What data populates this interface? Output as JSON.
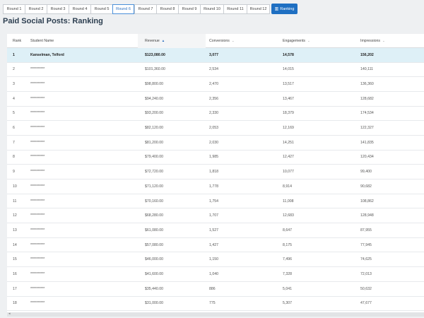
{
  "rounds": [
    "Round 1",
    "Round 2",
    "Round 3",
    "Round 4",
    "Round 5",
    "Round 6",
    "Round 7",
    "Round 8",
    "Round 9",
    "Round 10",
    "Round 11",
    "Round 12"
  ],
  "active_round": "Round 6",
  "ranking_button": {
    "label": "Ranking",
    "icon": "chart-icon"
  },
  "page_title": "Paid Social Posts: Ranking",
  "table": {
    "headers": {
      "rank": "Rank",
      "name": "Student Name",
      "revenue": "Revenue",
      "conversions": "Conversions",
      "engagements": "Engagements",
      "impressions": "Impressions"
    },
    "rows": [
      {
        "rank": "1",
        "name": "Kanselman, Telford",
        "revenue": "$123,080.00",
        "conversions": "3,077",
        "engagements": "14,578",
        "impressions": "156,202"
      },
      {
        "rank": "2",
        "name": "**********",
        "revenue": "$101,360.00",
        "conversions": "2,534",
        "engagements": "14,015",
        "impressions": "140,111"
      },
      {
        "rank": "3",
        "name": "**********",
        "revenue": "$98,800.00",
        "conversions": "2,470",
        "engagements": "13,517",
        "impressions": "136,360"
      },
      {
        "rank": "4",
        "name": "**********",
        "revenue": "$94,240.00",
        "conversions": "2,356",
        "engagements": "13,467",
        "impressions": "128,682"
      },
      {
        "rank": "5",
        "name": "**********",
        "revenue": "$93,200.00",
        "conversions": "2,330",
        "engagements": "18,379",
        "impressions": "174,534"
      },
      {
        "rank": "6",
        "name": "**********",
        "revenue": "$82,120.00",
        "conversions": "2,053",
        "engagements": "12,169",
        "impressions": "122,327"
      },
      {
        "rank": "7",
        "name": "**********",
        "revenue": "$81,200.00",
        "conversions": "2,030",
        "engagements": "14,251",
        "impressions": "141,835"
      },
      {
        "rank": "8",
        "name": "**********",
        "revenue": "$79,400.00",
        "conversions": "1,985",
        "engagements": "12,427",
        "impressions": "120,434"
      },
      {
        "rank": "9",
        "name": "**********",
        "revenue": "$72,720.00",
        "conversions": "1,818",
        "engagements": "10,077",
        "impressions": "99,400"
      },
      {
        "rank": "10",
        "name": "**********",
        "revenue": "$71,120.00",
        "conversions": "1,778",
        "engagements": "8,914",
        "impressions": "90,682"
      },
      {
        "rank": "11",
        "name": "**********",
        "revenue": "$70,160.00",
        "conversions": "1,754",
        "engagements": "11,008",
        "impressions": "108,862"
      },
      {
        "rank": "12",
        "name": "**********",
        "revenue": "$68,280.00",
        "conversions": "1,707",
        "engagements": "12,683",
        "impressions": "128,948"
      },
      {
        "rank": "13",
        "name": "**********",
        "revenue": "$61,080.00",
        "conversions": "1,527",
        "engagements": "8,647",
        "impressions": "87,955"
      },
      {
        "rank": "14",
        "name": "**********",
        "revenue": "$57,080.00",
        "conversions": "1,427",
        "engagements": "8,175",
        "impressions": "77,945"
      },
      {
        "rank": "15",
        "name": "**********",
        "revenue": "$46,000.00",
        "conversions": "1,150",
        "engagements": "7,496",
        "impressions": "74,625"
      },
      {
        "rank": "16",
        "name": "**********",
        "revenue": "$41,600.00",
        "conversions": "1,040",
        "engagements": "7,328",
        "impressions": "72,013"
      },
      {
        "rank": "17",
        "name": "**********",
        "revenue": "$35,440.00",
        "conversions": "886",
        "engagements": "5,041",
        "impressions": "50,632"
      },
      {
        "rank": "18",
        "name": "**********",
        "revenue": "$31,000.00",
        "conversions": "775",
        "engagements": "5,307",
        "impressions": "47,677"
      }
    ]
  },
  "colors": {
    "accent": "#1e6fc2",
    "highlight_row": "#def0f7",
    "background": "#eef0f2"
  }
}
